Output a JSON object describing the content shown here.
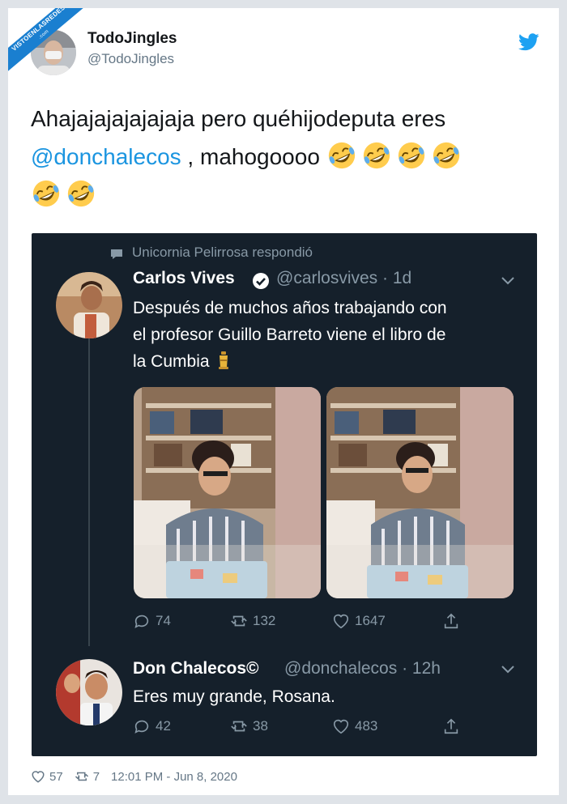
{
  "watermark": {
    "line1": "VISTOENLASREDES",
    "line2": ".com"
  },
  "tweet": {
    "author_name": "TodoJingles",
    "author_handle": "@TodoJingles",
    "text_part1": "Ahajajajajajajaja pero quéhijodeputa eres",
    "mention": "@donchalecos",
    "text_part2": " , mahogoooo",
    "emoji_name": "rofl-emoji",
    "brand_color": "#1da1f2"
  },
  "screenshot": {
    "replied_label": "Unicornia Pelirrosa respondió",
    "first": {
      "name": "Carlos Vives",
      "handle": "@carlosvives · 1d",
      "text_line1": "Después de muchos años trabajando con",
      "text_line2": "el profesor Guillo Barreto viene el libro de",
      "text_line3": "la Cumbia",
      "reply_count": "74",
      "retweet_count": "132",
      "like_count": "1647"
    },
    "second": {
      "name": "Don Chalecos©",
      "handle": "@donchalecos · 12h",
      "text": "Eres muy grande, Rosana.",
      "reply_count": "42",
      "retweet_count": "38",
      "like_count": "483"
    }
  },
  "footer": {
    "likes": "57",
    "retweets": "7",
    "timestamp": "12:01 PM - Jun 8, 2020"
  }
}
